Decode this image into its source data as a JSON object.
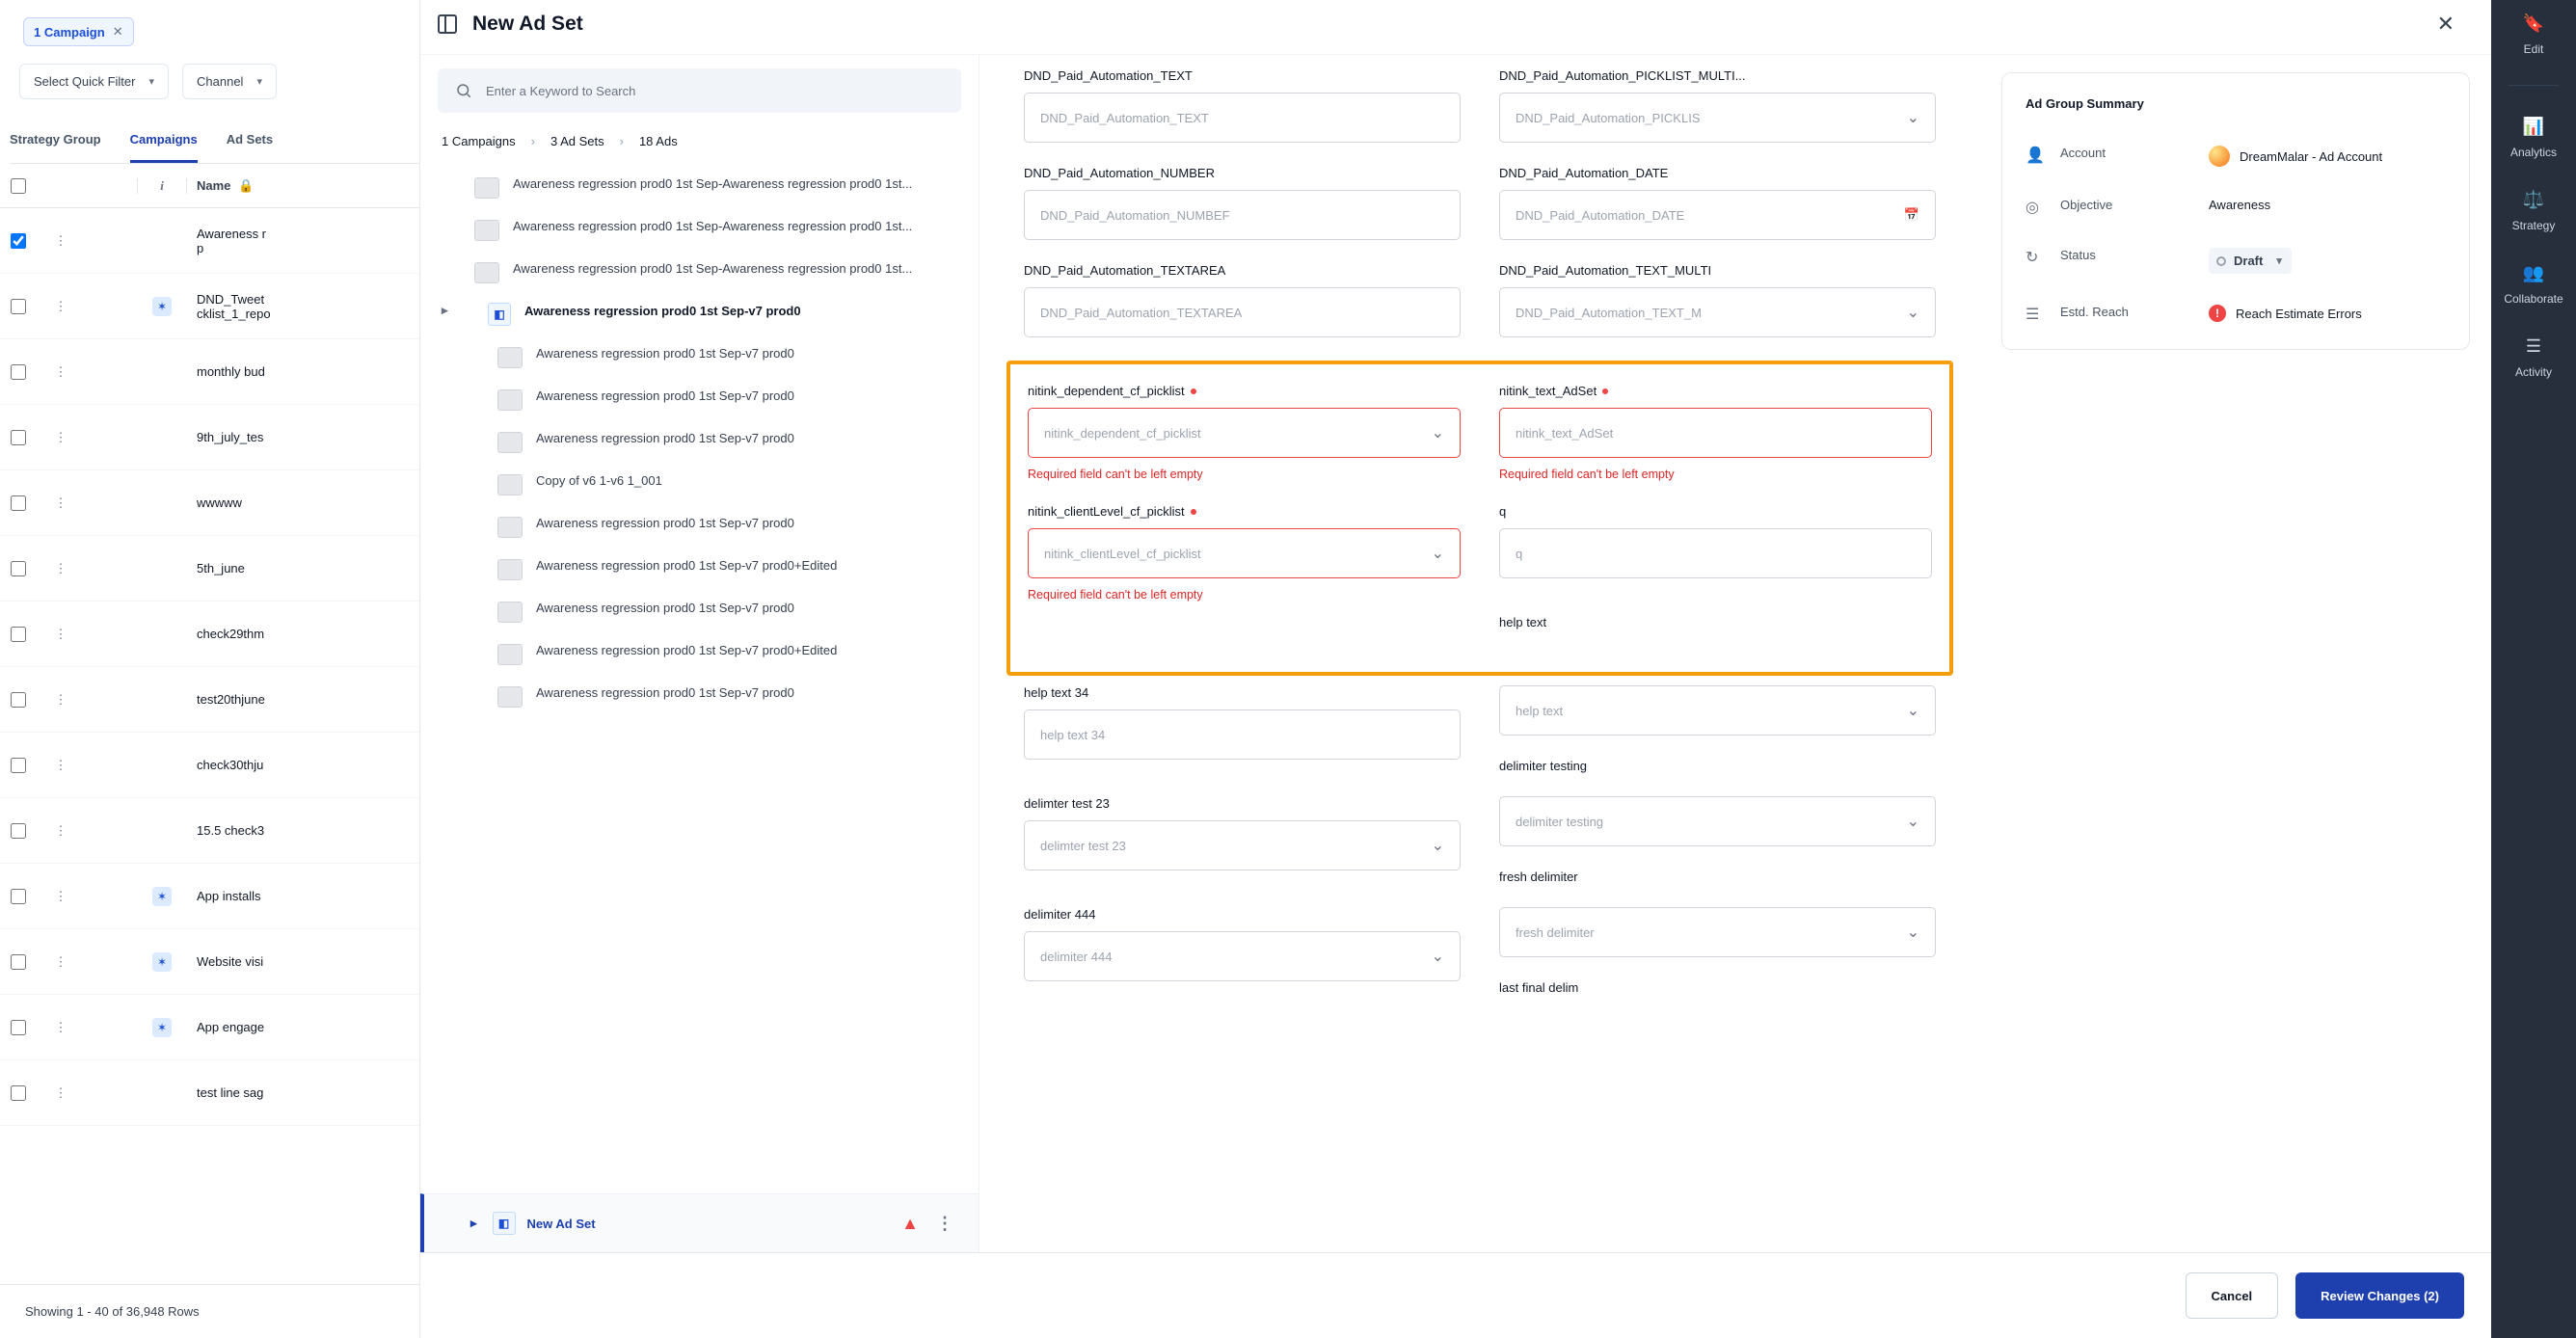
{
  "chip": {
    "label": "1 Campaign",
    "close": "✕"
  },
  "filters": {
    "quick": "Select Quick Filter",
    "channel": "Channel"
  },
  "tabs": {
    "strategy": "Strategy Group",
    "campaigns": "Campaigns",
    "adsets": "Ad Sets"
  },
  "table": {
    "headers": {
      "info": "i",
      "name": "Name",
      "lock": "🔒"
    },
    "rows": [
      {
        "name": "Awareness r\np",
        "checked": true
      },
      {
        "name": "DND_Tweet\ncklist_1_repo",
        "target": true
      },
      {
        "name": "monthly bud"
      },
      {
        "name": "9th_july_tes"
      },
      {
        "name": "wwwww"
      },
      {
        "name": "5th_june"
      },
      {
        "name": "check29thm"
      },
      {
        "name": "test20thjune"
      },
      {
        "name": "check30thju"
      },
      {
        "name": "15.5 check3"
      },
      {
        "name": "App installs",
        "target": true
      },
      {
        "name": "Website visi",
        "target": true
      },
      {
        "name": "App engage",
        "target": true
      },
      {
        "name": "test line sag"
      }
    ],
    "footer": "Showing 1 - 40 of 36,948 Rows"
  },
  "rail": {
    "edit": "Edit",
    "analytics": "Analytics",
    "strategy": "Strategy",
    "collaborate": "Collaborate",
    "activity": "Activity"
  },
  "modal": {
    "title": "New Ad Set",
    "search_ph": "Enter a Keyword to Search",
    "crumbs": {
      "a": "1 Campaigns",
      "b": "3 Ad Sets",
      "c": "18 Ads"
    },
    "left_items": [
      "Awareness regression prod0 1st Sep-Awareness regression prod0 1st...",
      "Awareness regression prod0 1st Sep-Awareness regression prod0 1st...",
      "Awareness regression prod0 1st Sep-Awareness regression prod0 1st..."
    ],
    "left_selected": "Awareness regression prod0 1st Sep-v7 prod0",
    "left_children": [
      "Awareness regression prod0 1st Sep-v7 prod0",
      "Awareness regression prod0 1st Sep-v7 prod0",
      "Awareness regression prod0 1st Sep-v7 prod0",
      "Copy of v6 1-v6 1_001",
      "Awareness regression prod0 1st Sep-v7 prod0",
      "Awareness regression prod0 1st Sep-v7 prod0+Edited",
      "Awareness regression prod0 1st Sep-v7 prod0",
      "Awareness regression prod0 1st Sep-v7 prod0+Edited",
      "Awareness regression prod0 1st Sep-v7 prod0"
    ],
    "new_adset": "New Ad Set",
    "fields": {
      "text_l": "DND_Paid_Automation_TEXT",
      "text_ph": "DND_Paid_Automation_TEXT",
      "pick_l": "DND_Paid_Automation_PICKLIST_MULTI...",
      "pick_ph": "DND_Paid_Automation_PICKLIS",
      "num_l": "DND_Paid_Automation_NUMBER",
      "num_ph": "DND_Paid_Automation_NUMBEF",
      "date_l": "DND_Paid_Automation_DATE",
      "date_ph": "DND_Paid_Automation_DATE",
      "ta_l": "DND_Paid_Automation_TEXTAREA",
      "ta_ph": "DND_Paid_Automation_TEXTAREA",
      "tm_l": "DND_Paid_Automation_TEXT_MULTI",
      "tm_ph": "DND_Paid_Automation_TEXT_M",
      "dep_pick_l": "nitink_dependent_cf_picklist",
      "dep_pick_ph": "nitink_dependent_cf_picklist",
      "txt_adset_l": "nitink_text_AdSet",
      "txt_adset_ph": "nitink_text_AdSet",
      "client_pick_l": "nitink_clientLevel_cf_picklist",
      "client_pick_ph": "nitink_clientLevel_cf_picklist",
      "q_l": "q",
      "q_ph": "q",
      "err": "Required field can't be left empty",
      "help_l": "help text",
      "help_ph": "help text",
      "help34_l": "help text 34",
      "help34_ph": "help text 34",
      "delimt_l": "delimiter testing",
      "delimt_ph": "delimiter testing",
      "delim23_l": "delimter test 23",
      "delim23_ph": "delimter test 23",
      "fresh_l": "fresh delimiter",
      "fresh_ph": "fresh delimiter",
      "delim444_l": "delimiter 444",
      "delim444_ph": "delimiter 444",
      "lastfinal_l": "last final delim"
    },
    "summary": {
      "title": "Ad Group Summary",
      "account_l": "Account",
      "account_v": "DreamMalar - Ad Account",
      "objective_l": "Objective",
      "objective_v": "Awareness",
      "status_l": "Status",
      "status_v": "Draft",
      "reach_l": "Estd. Reach",
      "reach_v": "Reach Estimate Errors"
    },
    "footer": {
      "cancel": "Cancel",
      "review": "Review Changes (2)"
    }
  }
}
